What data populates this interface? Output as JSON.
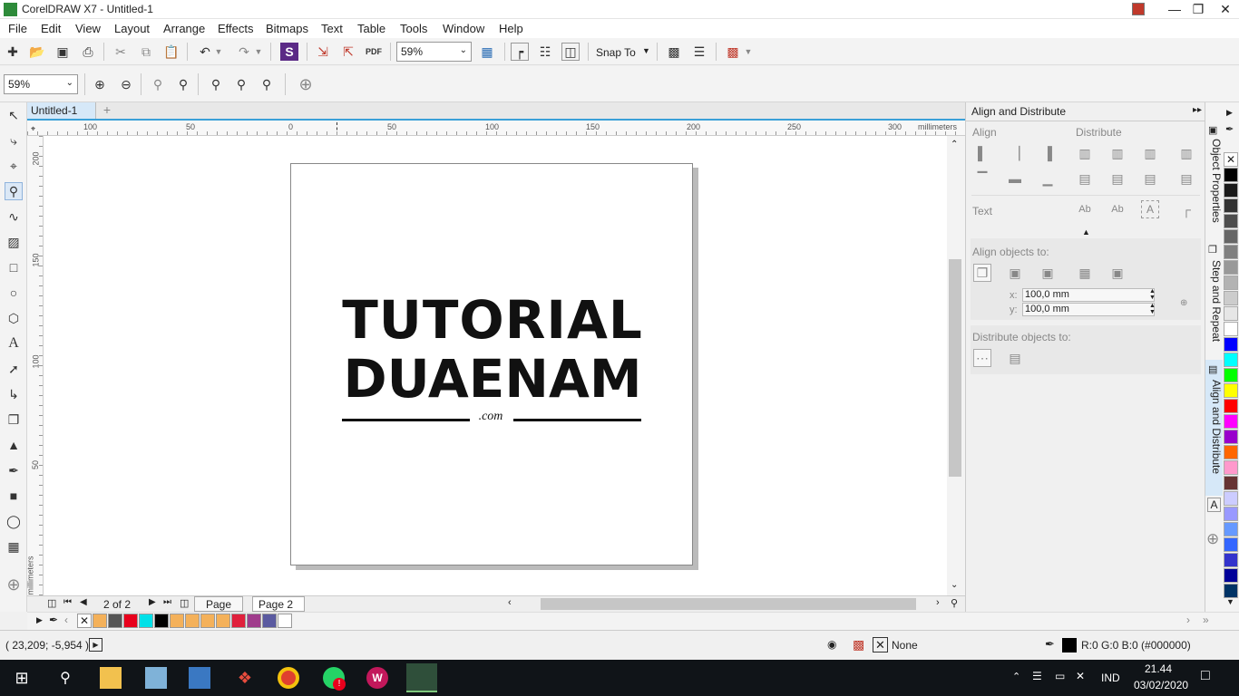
{
  "window": {
    "title": "CorelDRAW X7 - Untitled-1"
  },
  "menu": [
    "File",
    "Edit",
    "View",
    "Layout",
    "Arrange",
    "Effects",
    "Bitmaps",
    "Text",
    "Table",
    "Tools",
    "Window",
    "Help"
  ],
  "toolbar": {
    "zoom": "59%",
    "snap_to": "Snap To"
  },
  "propbar": {
    "zoom": "59%"
  },
  "doc_tab": "Untitled-1",
  "ruler": {
    "h_ticks": [
      "100",
      "50",
      "0",
      "50",
      "100",
      "150",
      "200",
      "250",
      "300"
    ],
    "h_unit": "millimeters",
    "v_ticks": [
      "200",
      "150",
      "100",
      "50"
    ],
    "v_unit": "millimeters"
  },
  "artwork": {
    "line1": "TUTORIAL",
    "line2": "DUAENAM",
    "suffix": ".com"
  },
  "pages": {
    "count": "2 of 2",
    "tabs": [
      "Page 1",
      "Page 2"
    ]
  },
  "docker": {
    "title": "Align and Distribute",
    "align": "Align",
    "distribute": "Distribute",
    "text": "Text",
    "align_to": "Align objects to:",
    "x_label": "x:",
    "x_value": "100,0 mm",
    "y_label": "y:",
    "y_value": "100,0 mm",
    "distribute_to": "Distribute objects to:"
  },
  "docker_tabs": [
    "Object Properties",
    "Step and Repeat",
    "Align and Distribute"
  ],
  "status": {
    "coords": "( 23,209; -5,954 )",
    "fill": "None",
    "outline": "R:0 G:0 B:0 (#000000)"
  },
  "taskbar": {
    "lang": "IND",
    "time": "21.44",
    "date": "03/02/2020"
  },
  "colors": {
    "accent": "#3aa0d8",
    "doc_palette": [
      "#f4b15a",
      "#555555",
      "#e8001c",
      "#00e0e8",
      "#000000",
      "#f4b15a",
      "#f4b15a",
      "#f4b15a",
      "#f4b15a",
      "#e0203c",
      "#a03c8c",
      "#5a5aa0",
      "#ffffff"
    ],
    "palette": [
      "#000000",
      "#1a1a1a",
      "#333333",
      "#4d4d4d",
      "#666666",
      "#808080",
      "#999999",
      "#b3b3b3",
      "#cccccc",
      "#e6e6e6",
      "#ffffff",
      "#0000ff",
      "#00ffff",
      "#00ff00",
      "#ffff00",
      "#ff0000",
      "#ff00ff",
      "#9900cc",
      "#ff6600",
      "#ff99cc",
      "#663333",
      "#ccccff",
      "#9999ff",
      "#6699ff",
      "#3366ff",
      "#3333cc",
      "#000099",
      "#003366"
    ]
  }
}
